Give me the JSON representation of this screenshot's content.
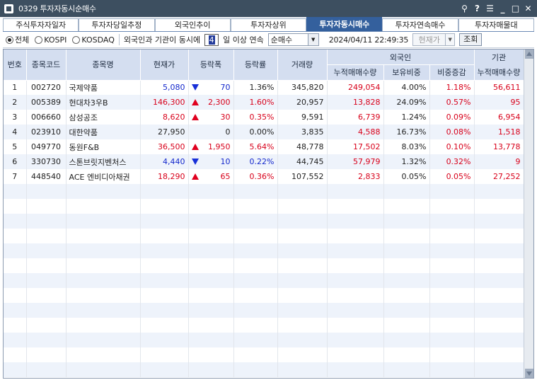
{
  "window": {
    "title": "0329 투자자동시순매수"
  },
  "titlebar_icons": [
    "pin-icon",
    "help-icon",
    "menu-icon",
    "minimize-icon",
    "maximize-icon",
    "close-icon"
  ],
  "titlebar_glyphs": {
    "pin": "⚲",
    "help": "?",
    "menu": "☰",
    "minimize": "_",
    "maximize": "□",
    "close": "✕"
  },
  "tabs": [
    {
      "label": "주식투자자일자",
      "active": false
    },
    {
      "label": "투자자당일추정",
      "active": false
    },
    {
      "label": "외국인추이",
      "active": false
    },
    {
      "label": "투자자상위",
      "active": false
    },
    {
      "label": "투자자동시매수",
      "active": true
    },
    {
      "label": "투자자연속매수",
      "active": false
    },
    {
      "label": "투자자매물대",
      "active": false
    }
  ],
  "toolbar": {
    "market_options": [
      {
        "label": "전체",
        "selected": true
      },
      {
        "label": "KOSPI",
        "selected": false
      },
      {
        "label": "KOSDAQ",
        "selected": false
      }
    ],
    "condition_prefix": "외국인과 기관이 동시에",
    "days": "4",
    "condition_suffix": "일 이상 연속",
    "type_select": "순매수",
    "datetime": "2024/04/11  22:49:35",
    "price_select": "현재가",
    "query_button": "조회"
  },
  "table": {
    "headers": {
      "no": "번호",
      "code": "종목코드",
      "name": "종목명",
      "price": "현재가",
      "change": "등락폭",
      "rate": "등락률",
      "volume": "거래량",
      "foreign_group": "외국인",
      "foreign_net": "누적매매수량",
      "foreign_hold": "보유비중",
      "foreign_diff": "비중증감",
      "inst_group": "기관",
      "inst_net": "누적매매수량"
    },
    "rows": [
      {
        "no": "1",
        "code": "002720",
        "name": "국제약품",
        "price": "5,080",
        "price_color": "blue",
        "dir": "down",
        "change": "70",
        "rate": "1.36%",
        "rate_color": "black",
        "volume": "345,820",
        "foreign_net": "249,054",
        "foreign_hold": "4.00%",
        "foreign_diff": "1.18%",
        "inst_net": "56,611"
      },
      {
        "no": "2",
        "code": "005389",
        "name": "현대차3우B",
        "price": "146,300",
        "price_color": "red",
        "dir": "up",
        "change": "2,300",
        "rate": "1.60%",
        "rate_color": "red",
        "volume": "20,957",
        "foreign_net": "13,828",
        "foreign_hold": "24.09%",
        "foreign_diff": "0.57%",
        "inst_net": "95"
      },
      {
        "no": "3",
        "code": "006660",
        "name": "삼성공조",
        "price": "8,620",
        "price_color": "red",
        "dir": "up",
        "change": "30",
        "rate": "0.35%",
        "rate_color": "red",
        "volume": "9,591",
        "foreign_net": "6,739",
        "foreign_hold": "1.24%",
        "foreign_diff": "0.09%",
        "inst_net": "6,954"
      },
      {
        "no": "4",
        "code": "023910",
        "name": "대한약품",
        "price": "27,950",
        "price_color": "black",
        "dir": "none",
        "change": "0",
        "rate": "0.00%",
        "rate_color": "black",
        "volume": "3,835",
        "foreign_net": "4,588",
        "foreign_hold": "16.73%",
        "foreign_diff": "0.08%",
        "inst_net": "1,518"
      },
      {
        "no": "5",
        "code": "049770",
        "name": "동원F&B",
        "price": "36,500",
        "price_color": "red",
        "dir": "up",
        "change": "1,950",
        "rate": "5.64%",
        "rate_color": "red",
        "volume": "48,778",
        "foreign_net": "17,502",
        "foreign_hold": "8.03%",
        "foreign_diff": "0.10%",
        "inst_net": "13,778"
      },
      {
        "no": "6",
        "code": "330730",
        "name": "스톤브릿지벤처스",
        "price": "4,440",
        "price_color": "blue",
        "dir": "down",
        "change": "10",
        "rate": "0.22%",
        "rate_color": "blue",
        "volume": "44,745",
        "foreign_net": "57,979",
        "foreign_hold": "1.32%",
        "foreign_diff": "0.32%",
        "inst_net": "9"
      },
      {
        "no": "7",
        "code": "448540",
        "name": "ACE 엔비디아채권",
        "price": "18,290",
        "price_color": "red",
        "dir": "up",
        "change": "65",
        "rate": "0.36%",
        "rate_color": "red",
        "volume": "107,552",
        "foreign_net": "2,833",
        "foreign_hold": "0.05%",
        "foreign_diff": "0.05%",
        "inst_net": "27,252"
      }
    ]
  },
  "colors": {
    "titlebar": "#3d4f60",
    "active_tab": "#34609d",
    "header": "#d4def0",
    "even_row": "#eef3fb",
    "up": "#d8001a",
    "down": "#1428cc"
  }
}
